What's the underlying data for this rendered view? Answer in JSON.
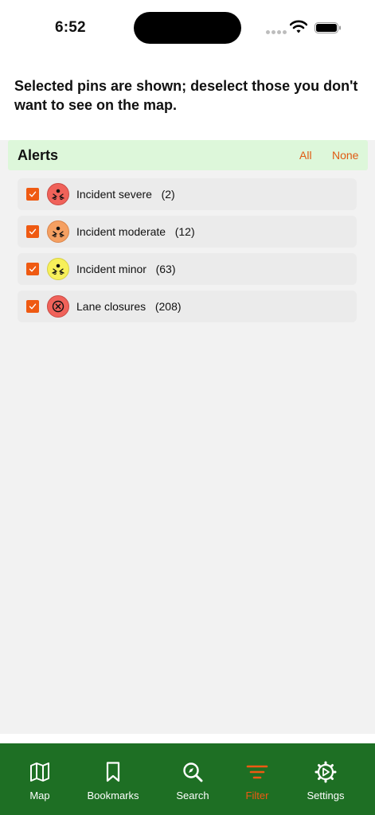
{
  "status_bar": {
    "time": "6:52"
  },
  "instruction": "Selected pins are shown; deselect those you don't want to see on the map.",
  "section": {
    "title": "Alerts",
    "all_label": "All",
    "none_label": "None",
    "items": [
      {
        "label": "Incident severe   (2)",
        "checked": true,
        "icon": "incident-icon",
        "color": "#f0625a"
      },
      {
        "label": "Incident moderate   (12)",
        "checked": true,
        "icon": "incident-icon",
        "color": "#f5a062"
      },
      {
        "label": "Incident minor   (63)",
        "checked": true,
        "icon": "incident-icon",
        "color": "#f7f05a"
      },
      {
        "label": "Lane closures   (208)",
        "checked": true,
        "icon": "closed-circle-icon",
        "color": "#f0625a"
      }
    ]
  },
  "tabs": [
    {
      "label": "Map",
      "icon": "map-icon",
      "active": false
    },
    {
      "label": "Bookmarks",
      "icon": "bookmark-icon",
      "active": false
    },
    {
      "label": "Search",
      "icon": "search-icon",
      "active": false
    },
    {
      "label": "Filter",
      "icon": "filter-icon",
      "active": true
    },
    {
      "label": "Settings",
      "icon": "gear-icon",
      "active": false
    }
  ],
  "colors": {
    "accent": "#ef5a12",
    "tab_bar": "#1e6f24",
    "header_bg": "#ddf7da"
  }
}
